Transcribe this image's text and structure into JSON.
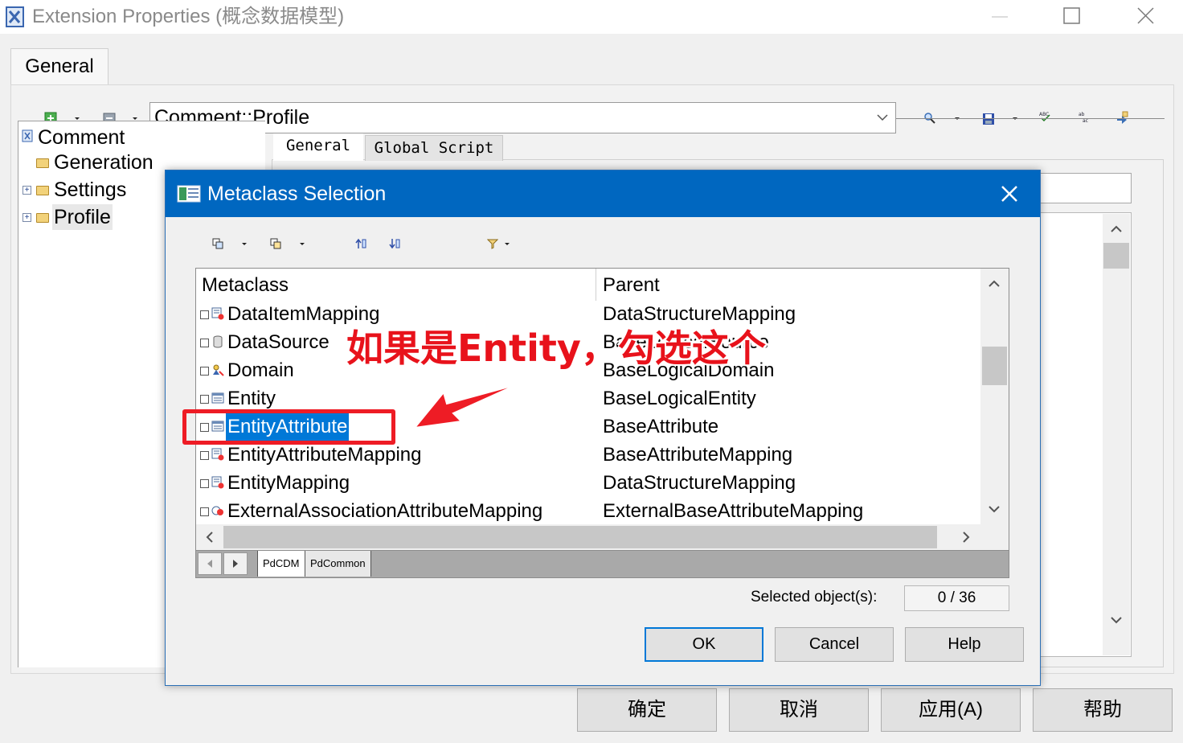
{
  "window": {
    "title": "Extension Properties (概念数据模型)",
    "tab_general": "General"
  },
  "toolbar": {
    "profile_path": "Comment::Profile"
  },
  "tree": {
    "items": [
      {
        "label": "Comment",
        "icon": "extension-icon"
      },
      {
        "label": "Generation",
        "icon": "folder-icon"
      },
      {
        "label": "Settings",
        "icon": "folder-icon"
      },
      {
        "label": "Profile",
        "icon": "folder-icon"
      }
    ]
  },
  "right_tabs": {
    "general": "General",
    "global_script": "Global Script"
  },
  "bottom_buttons": {
    "confirm": "确定",
    "cancel": "取消",
    "apply": "应用(A)",
    "help": "帮助"
  },
  "dialog": {
    "title": "Metaclass Selection",
    "columns": {
      "metaclass": "Metaclass",
      "parent": "Parent"
    },
    "rows": [
      {
        "metaclass": "DataItemMapping",
        "parent": "DataStructureMapping",
        "icon": "mapping-icon",
        "checked": false
      },
      {
        "metaclass": "DataSource",
        "parent": "BaseLogicalSource",
        "icon": "datasource-icon",
        "checked": false
      },
      {
        "metaclass": "Domain",
        "parent": "BaseLogicalDomain",
        "icon": "domain-icon",
        "checked": false
      },
      {
        "metaclass": "Entity",
        "parent": "BaseLogicalEntity",
        "icon": "entity-icon",
        "checked": false
      },
      {
        "metaclass": "EntityAttribute",
        "parent": "BaseAttribute",
        "icon": "entity-icon",
        "checked": false,
        "selected": true
      },
      {
        "metaclass": "EntityAttributeMapping",
        "parent": "BaseAttributeMapping",
        "icon": "mapping-icon",
        "checked": false
      },
      {
        "metaclass": "EntityMapping",
        "parent": "DataStructureMapping",
        "icon": "mapping-icon",
        "checked": false
      },
      {
        "metaclass": "ExternalAssociationAttributeMapping",
        "parent": "ExternalBaseAttributeMapping",
        "icon": "external-mapping-icon",
        "checked": false
      }
    ],
    "library_tabs": [
      "PdCDM",
      "PdCommon"
    ],
    "selected_label": "Selected object(s):",
    "selected_count": "0 / 36",
    "buttons": {
      "ok": "OK",
      "cancel": "Cancel",
      "help": "Help"
    }
  },
  "annotation": {
    "text": "如果是Entity，勾选这个",
    "color": "#e8121b"
  }
}
